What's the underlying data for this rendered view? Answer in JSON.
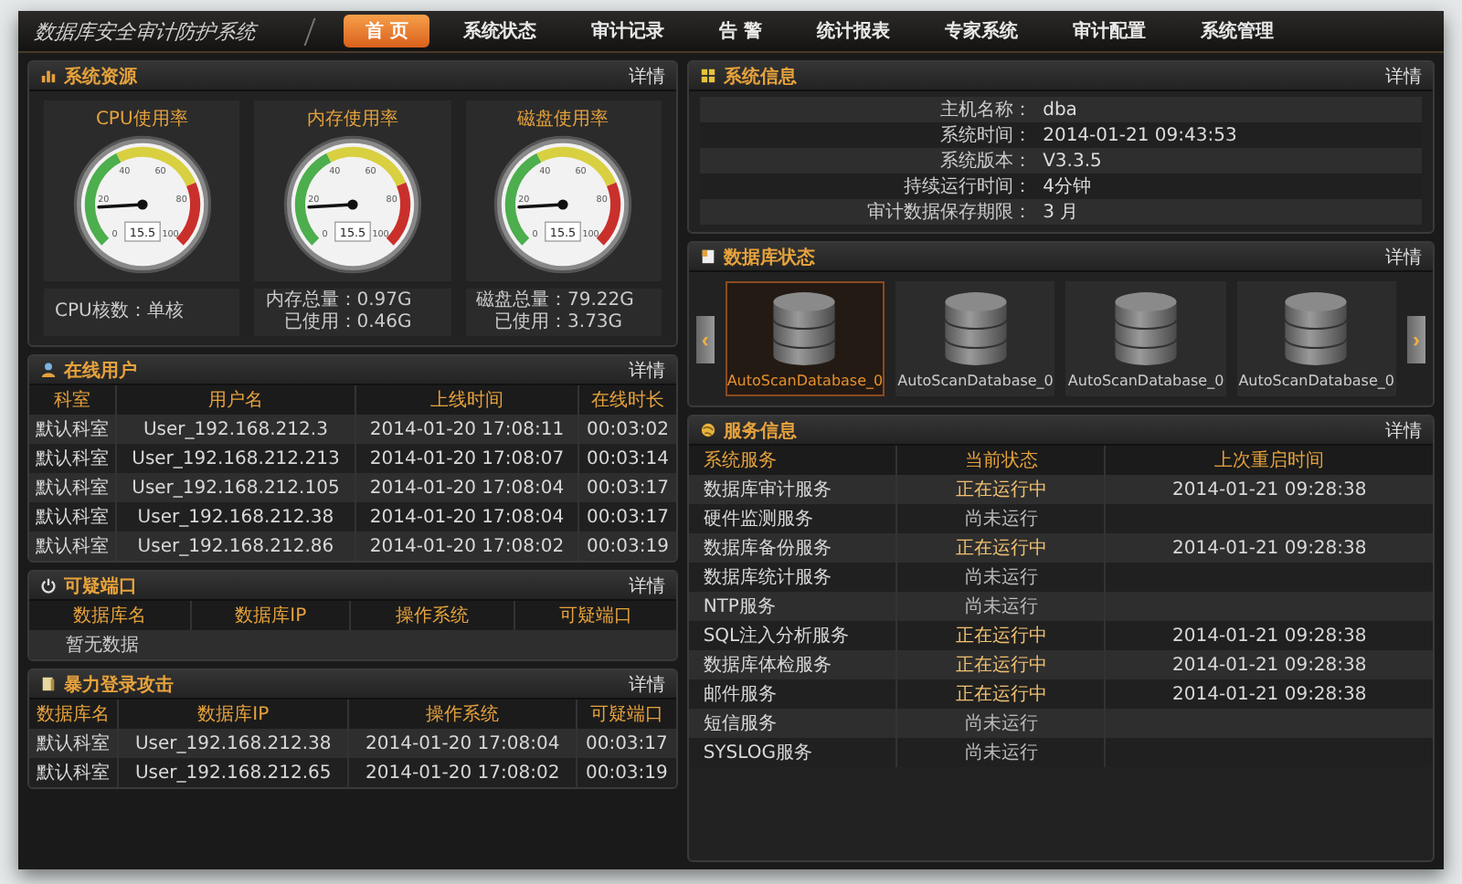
{
  "header": {
    "title": "数据库安全审计防护系统"
  },
  "nav": [
    {
      "label": "首 页",
      "selected": true
    },
    {
      "label": "系统状态",
      "selected": false
    },
    {
      "label": "审计记录",
      "selected": false
    },
    {
      "label": "告 警",
      "selected": false
    },
    {
      "label": "统计报表",
      "selected": false
    },
    {
      "label": "专家系统",
      "selected": false
    },
    {
      "label": "审计配置",
      "selected": false
    },
    {
      "label": "系统管理",
      "selected": false
    }
  ],
  "system_resources": {
    "title": "系统资源",
    "detail": "详情",
    "gauges": [
      {
        "title": "CPU使用率",
        "reading": "15.5",
        "ticks": [
          "0",
          "20",
          "40",
          "60",
          "80",
          "100"
        ],
        "info": [
          "CPU核数：单核"
        ]
      },
      {
        "title": "内存使用率",
        "reading": "15.5",
        "ticks": [
          "0",
          "20",
          "40",
          "60",
          "80",
          "100"
        ],
        "info": [
          "内存总量：0.97G",
          "已使用：0.46G"
        ]
      },
      {
        "title": "磁盘使用率",
        "reading": "15.5",
        "ticks": [
          "0",
          "20",
          "40",
          "60",
          "80",
          "100"
        ],
        "info": [
          "磁盘总量：79.22G",
          "已使用：3.73G"
        ]
      }
    ]
  },
  "online_users": {
    "title": "在线用户",
    "detail": "详情",
    "columns": [
      "科室",
      "用户名",
      "上线时间",
      "在线时长"
    ],
    "rows": [
      [
        "默认科室",
        "User_192.168.212.3",
        "2014-01-20 17:08:11",
        "00:03:02"
      ],
      [
        "默认科室",
        "User_192.168.212.213",
        "2014-01-20 17:08:07",
        "00:03:14"
      ],
      [
        "默认科室",
        "User_192.168.212.105",
        "2014-01-20 17:08:04",
        "00:03:17"
      ],
      [
        "默认科室",
        "User_192.168.212.38",
        "2014-01-20 17:08:04",
        "00:03:17"
      ],
      [
        "默认科室",
        "User_192.168.212.86",
        "2014-01-20 17:08:02",
        "00:03:19"
      ]
    ]
  },
  "suspicious_ports": {
    "title": "可疑端口",
    "detail": "详情",
    "columns": [
      "数据库名",
      "数据库IP",
      "操作系统",
      "可疑端口"
    ],
    "empty": "暂无数据"
  },
  "brute_force_login": {
    "title": "暴力登录攻击",
    "detail": "详情",
    "columns": [
      "数据库名",
      "数据库IP",
      "操作系统",
      "可疑端口"
    ],
    "rows": [
      [
        "默认科室",
        "User_192.168.212.38",
        "2014-01-20 17:08:04",
        "00:03:17"
      ],
      [
        "默认科室",
        "User_192.168.212.65",
        "2014-01-20 17:08:02",
        "00:03:19"
      ]
    ]
  },
  "system_info": {
    "title": "系统信息",
    "detail": "详情",
    "fields": [
      {
        "label": "主机名称：",
        "value": "dba"
      },
      {
        "label": "系统时间：",
        "value": "2014-01-21 09:43:53"
      },
      {
        "label": "系统版本：",
        "value": "V3.3.5"
      },
      {
        "label": "持续运行时间：",
        "value": "4分钟"
      },
      {
        "label": "审计数据保存期限：",
        "value": "3 月"
      }
    ]
  },
  "database_status": {
    "title": "数据库状态",
    "detail": "详情",
    "prev": "‹",
    "next": "›",
    "items": [
      {
        "name": "AutoScanDatabase_0",
        "selected": true
      },
      {
        "name": "AutoScanDatabase_0",
        "selected": false
      },
      {
        "name": "AutoScanDatabase_0",
        "selected": false
      },
      {
        "name": "AutoScanDatabase_0",
        "selected": false
      }
    ]
  },
  "services": {
    "title": "服务信息",
    "detail": "详情",
    "columns": [
      "系统服务",
      "当前状态",
      "上次重启时间"
    ],
    "rows": [
      {
        "name": "数据库审计服务",
        "status": "正在运行中",
        "running": true,
        "restarted": "2014-01-21 09:28:38"
      },
      {
        "name": "硬件监测服务",
        "status": "尚未运行",
        "running": false
      },
      {
        "name": "数据库备份服务",
        "status": "正在运行中",
        "running": true,
        "restarted": "2014-01-21 09:28:38"
      },
      {
        "name": "数据库统计服务",
        "status": "尚未运行",
        "running": false
      },
      {
        "name": "NTP服务",
        "status": "尚未运行",
        "running": false
      },
      {
        "name": "SQL注入分析服务",
        "status": "正在运行中",
        "running": true,
        "restarted": "2014-01-21 09:28:38"
      },
      {
        "name": "数据库体检服务",
        "status": "正在运行中",
        "running": true,
        "restarted": "2014-01-21 09:28:38"
      },
      {
        "name": "邮件服务",
        "status": "正在运行中",
        "running": true,
        "restarted": "2014-01-21 09:28:38"
      },
      {
        "name": "短信服务",
        "status": "尚未运行",
        "running": false
      },
      {
        "name": "SYSLOG服务",
        "status": "尚未运行",
        "running": false
      }
    ]
  }
}
